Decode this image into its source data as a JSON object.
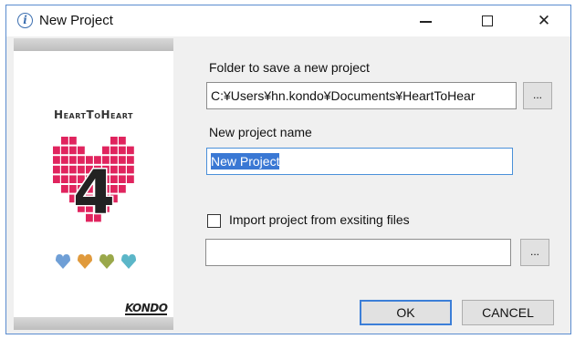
{
  "window": {
    "title": "New Project",
    "info_icon_glyph": "i",
    "close_glyph": "✕"
  },
  "banner": {
    "brand": "HeartToHeart",
    "logo_digit": "4",
    "logo_color": "#e0245e",
    "company": "KONDO"
  },
  "form": {
    "folder_label": "Folder to save a new project",
    "folder_value": "C:¥Users¥hn.kondo¥Documents¥HeartToHear",
    "folder_browse": "...",
    "name_label": "New project name",
    "name_value": "New Project",
    "import_label": "Import project from exsiting files",
    "import_checked": false,
    "import_value": "",
    "import_browse": "..."
  },
  "buttons": {
    "ok": "OK",
    "cancel": "CANCEL"
  },
  "colors": {
    "accent": "#3c7fd8",
    "selection": "#3a78d4",
    "window_border": "#5a8ccf"
  }
}
